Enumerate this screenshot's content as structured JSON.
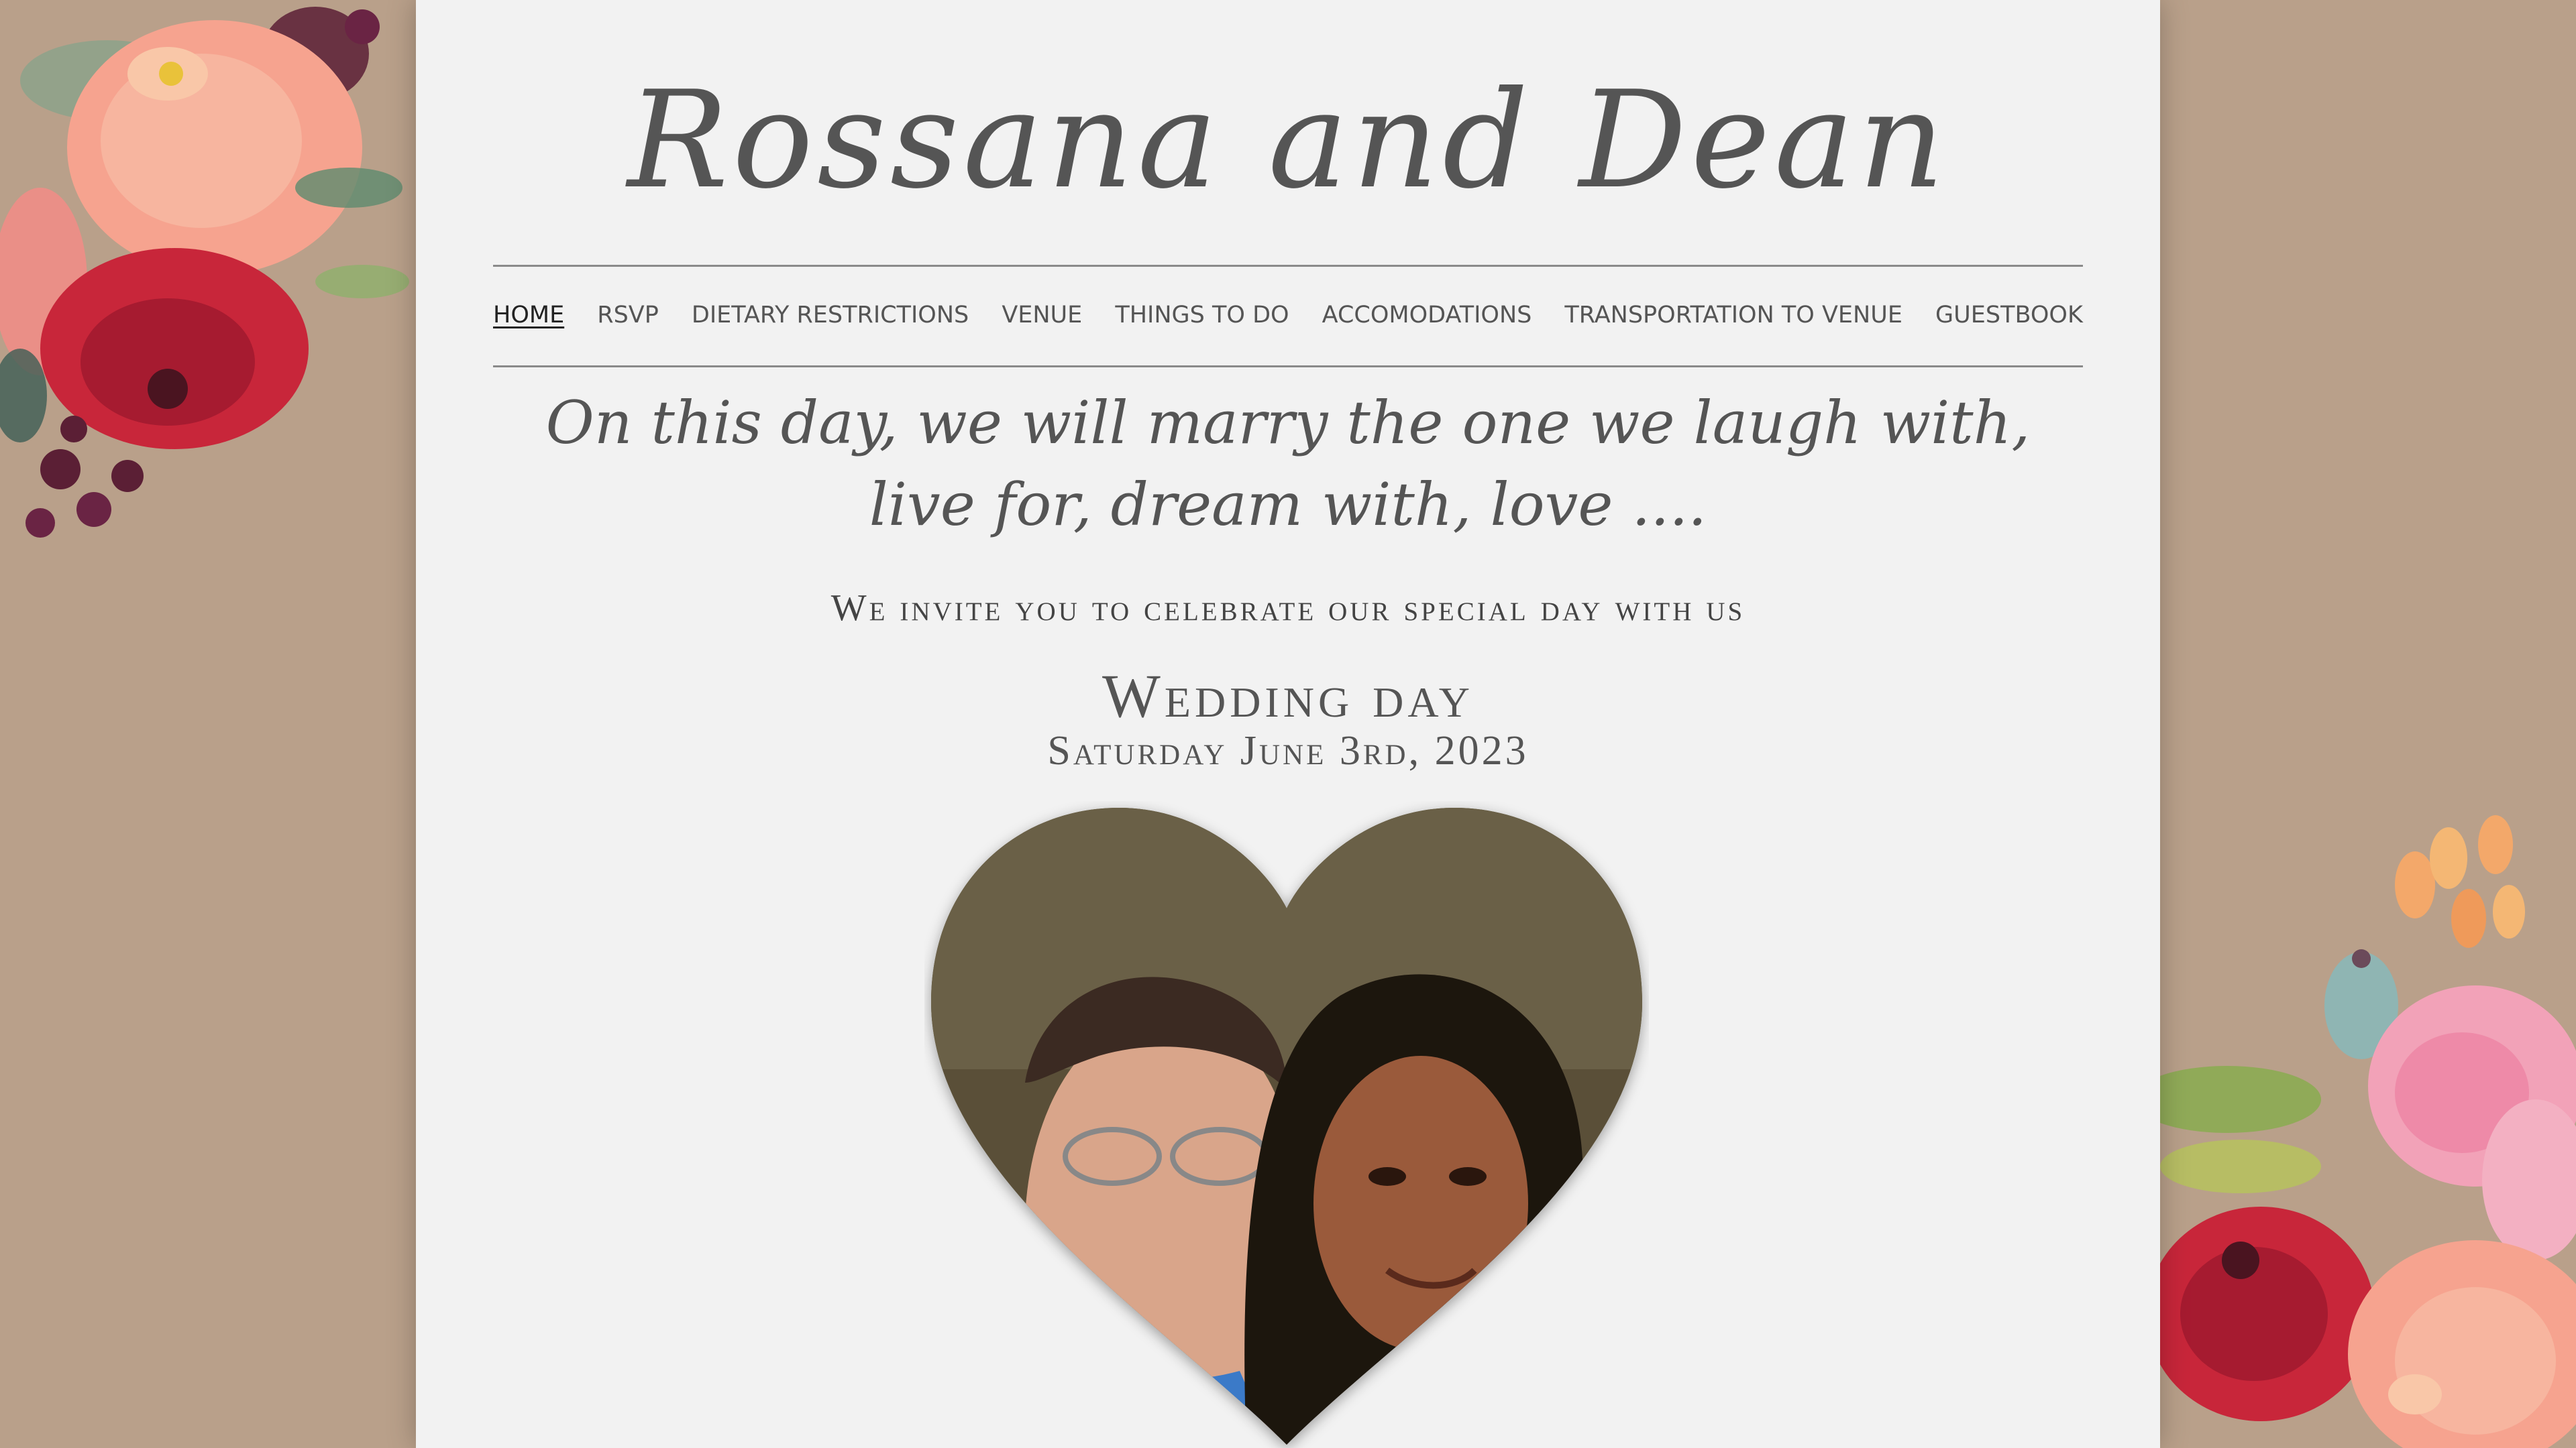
{
  "site": {
    "title": "Rossana and Dean"
  },
  "nav": {
    "items": [
      {
        "label": "HOME",
        "active": true
      },
      {
        "label": "RSVP"
      },
      {
        "label": "DIETARY RESTRICTIONS"
      },
      {
        "label": "VENUE"
      },
      {
        "label": "THINGS TO DO"
      },
      {
        "label": "ACCOMODATIONS"
      },
      {
        "label": "TRANSPORTATION TO VENUE"
      },
      {
        "label": "GUESTBOOK"
      }
    ]
  },
  "hero": {
    "quote_line1": "On this day, we will marry the one we laugh with,",
    "quote_line2": "live for, dream with, love ....",
    "invite": "We invite you to celebrate our special day with us",
    "wedding_day_label": "Wedding day",
    "date": "Saturday June 3rd, 2023"
  },
  "colors": {
    "background": "#b9a08a",
    "page": "#f2f2f2",
    "text": "#555555"
  }
}
